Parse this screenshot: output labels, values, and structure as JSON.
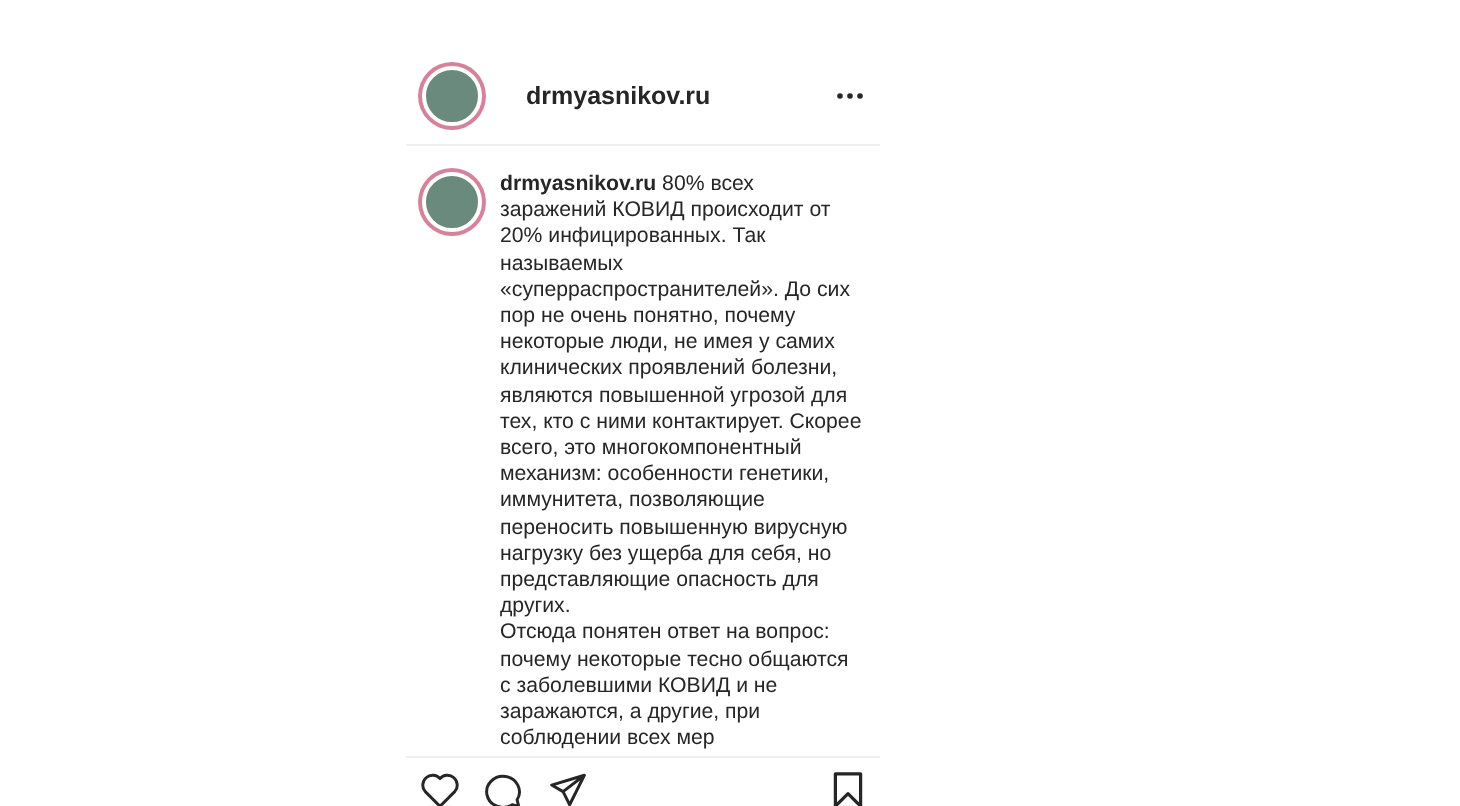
{
  "post": {
    "username": "drmyasnikov.ru",
    "caption": [
      "**drmyasnikov.ru** 80% всех заражений КОВИД происходит от 20% инфицированных. Так называемых «суперраспространителей». До сих пор не очень понятно, почему некоторые люди, не имея у самих клинических проявлений болезни, являются повышенной угрозой для тех, кто с ними контактирует. Скорее всего, это многокомпонентный механизм: особенности генетики, иммунитета, позволяющие переносить повышенную вирусную нагрузку без ущерба для себя, но представляющие опасность для других.",
      "Отсюда понятен ответ на вопрос: почему некоторые тесно общаются с заболевшими КОВИД и не заражаются, а другие, при соблюдении всех мер"
    ]
  }
}
